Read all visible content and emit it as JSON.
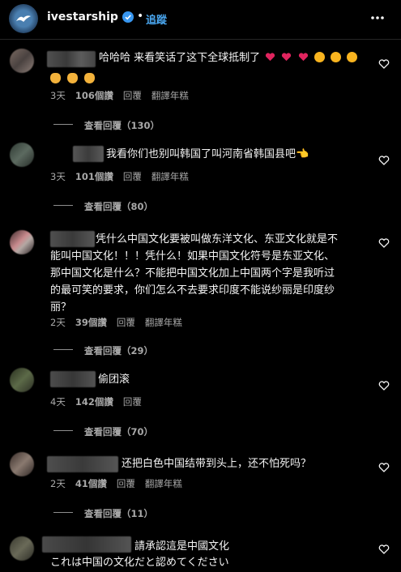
{
  "header": {
    "account": "ivestarship",
    "dot": "•",
    "follow": "追蹤"
  },
  "comments": [
    {
      "text_lines": [
        "哈哈哈 来看笑话了这下全球抵制了"
      ],
      "emoji": [
        "heart",
        "heart",
        "heart",
        "star-eyes",
        "star-eyes",
        "star-eyes",
        "clap",
        "clap",
        "clap"
      ],
      "time": "3天",
      "likes": "106個讚",
      "reply": "回覆",
      "translate": "翻譯年糕",
      "view_replies": "查看回覆（130）"
    },
    {
      "text_lines": [
        "我看你们也别叫韩国了叫河南省韩国县吧👈"
      ],
      "time": "3天",
      "likes": "101個讚",
      "reply": "回覆",
      "translate": "翻譯年糕",
      "view_replies": "查看回覆（80）"
    },
    {
      "text_lines": [
        "凭什么中国文化要被叫做东洋文化、东亚文化就是不",
        "能叫中国文化！！！凭什么！如果中国文化符号是东亚文化、",
        "那中国文化是什么？不能把中国文化加上中国两个字是我听过",
        "的最可笑的要求，你们怎么不去要求印度不能说纱丽是印度纱",
        "丽？"
      ],
      "time": "2天",
      "likes": "39個讚",
      "reply": "回覆",
      "translate": "翻譯年糕",
      "view_replies": "查看回覆（29）"
    },
    {
      "text_lines": [
        "偷团滚"
      ],
      "time": "4天",
      "likes": "142個讚",
      "reply": "回覆",
      "view_replies": "查看回覆（70）"
    },
    {
      "text_lines": [
        "还把白色中国结带到头上，还不怕死吗？"
      ],
      "time": "2天",
      "likes": "41個讚",
      "reply": "回覆",
      "translate": "翻譯年糕",
      "view_replies": "查看回覆（11）"
    },
    {
      "text_lines": [
        "請承認這是中國文化",
        "これは中国の文化だと認めてください"
      ]
    }
  ],
  "colors": {
    "background": "#000000",
    "text": "#f5f5f5",
    "muted": "#a8a8a8",
    "link": "#4aa7f0",
    "heart_emoji": "#e0245e"
  }
}
